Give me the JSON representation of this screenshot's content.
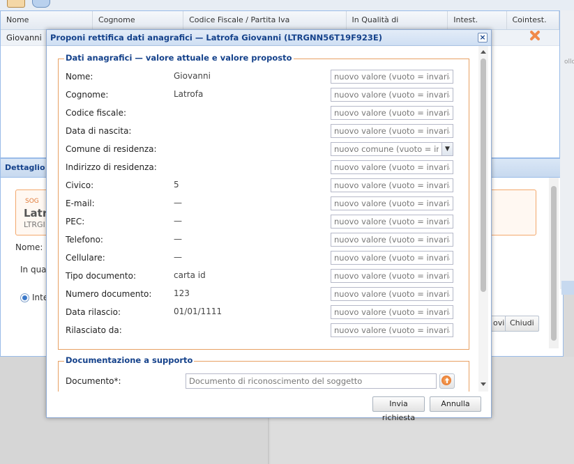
{
  "grid": {
    "columns": [
      "Nome",
      "Cognome",
      "Codice Fiscale / Partita Iva",
      "In Qualità di",
      "Intest.",
      "Cointest."
    ],
    "rows": [
      {
        "nome": "Giovanni"
      }
    ]
  },
  "detail": {
    "title": "Dettaglio s",
    "subject_tag": "SOG",
    "subject_name": "Latr",
    "subject_cf": "LTRGI",
    "nome_label": "Nome:",
    "qualita_label": "In qual",
    "radio_label": "Inte",
    "btn_save": "ovi",
    "btn_close": "Chiudi"
  },
  "side_text": "ollo",
  "modal": {
    "title": "Proponi rettifica dati anagrafici — Latrofa Giovanni (LTRGNN56T19F923E)",
    "close_glyph": "×",
    "section1_legend": "Dati anagrafici — valore attuale e valore proposto",
    "input_placeholder": "nuovo valore (vuoto = invariato)",
    "combo_placeholder": "nuovo comune (vuoto = invariato)",
    "combo_trigger_glyph": "▼",
    "fields": [
      {
        "label": "Nome:",
        "value": "Giovanni"
      },
      {
        "label": "Cognome:",
        "value": "Latrofa"
      },
      {
        "label": "Codice fiscale:",
        "value": ""
      },
      {
        "label": "Data di nascita:",
        "value": ""
      },
      {
        "label": "Comune di residenza:",
        "value": ""
      },
      {
        "label": "Indirizzo di residenza:",
        "value": ""
      },
      {
        "label": "Civico:",
        "value": "5"
      },
      {
        "label": "E-mail:",
        "value": "—"
      },
      {
        "label": "PEC:",
        "value": "—"
      },
      {
        "label": "Telefono:",
        "value": "—"
      },
      {
        "label": "Cellulare:",
        "value": "—"
      },
      {
        "label": "Tipo documento:",
        "value": "carta id"
      },
      {
        "label": "Numero documento:",
        "value": "123"
      },
      {
        "label": "Data rilascio:",
        "value": "01/01/1111"
      },
      {
        "label": "Rilasciato da:",
        "value": ""
      }
    ],
    "section2_legend": "Documentazione a supporto",
    "doc_label": "Documento*:",
    "doc_placeholder": "Documento di riconoscimento del soggetto",
    "btn_submit": "Invia richiesta",
    "btn_cancel": "Annulla"
  },
  "icons": {
    "close": "close-icon",
    "remove": "cross-icon",
    "upload": "upload-icon",
    "dropdown": "chevron-down-icon"
  },
  "colors": {
    "title_blue": "#15428b",
    "fieldset_border": "#e8a062",
    "accent_orange": "#f08a4b"
  }
}
